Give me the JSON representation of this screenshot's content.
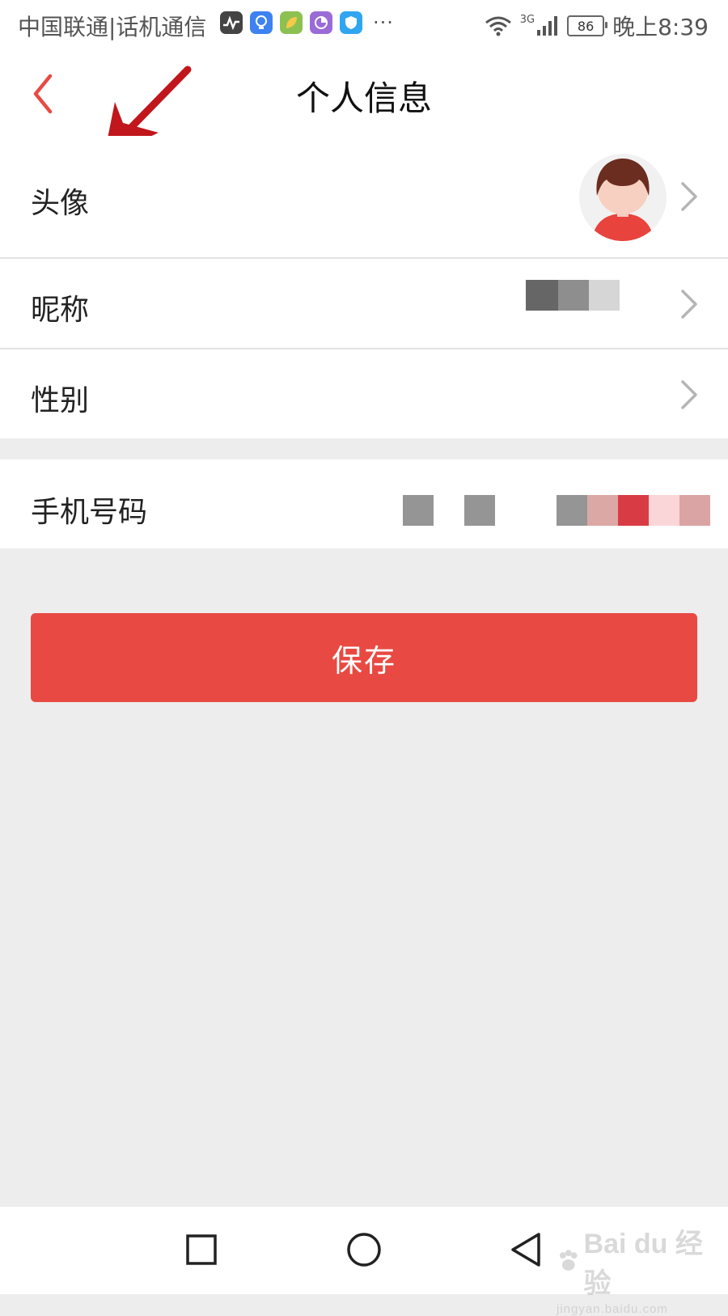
{
  "status_bar": {
    "carrier": "中国联通|话机通信",
    "more": "···",
    "network_type": "3G",
    "battery_level": "86",
    "time": "晚上8:39"
  },
  "header": {
    "title": "个人信息"
  },
  "profile": {
    "avatar_label": "头像",
    "nickname_label": "昵称",
    "gender_label": "性别",
    "phone_label": "手机号码"
  },
  "actions": {
    "save_label": "保存"
  },
  "watermark": {
    "brand": "Bai du 经验",
    "url": "jingyan.baidu.com"
  },
  "colors": {
    "accent": "#e84a43",
    "annotation_arrow": "#c0161c",
    "background": "#ededed"
  }
}
